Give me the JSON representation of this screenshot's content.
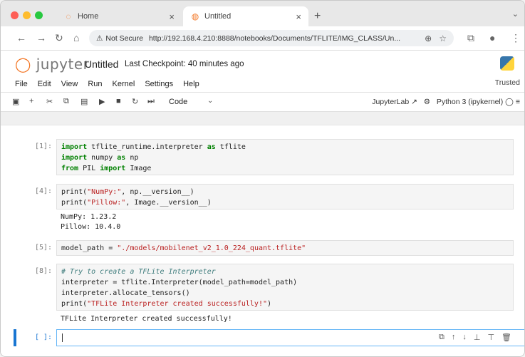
{
  "browser": {
    "tabs": [
      {
        "label": "Home",
        "icon": "loading-ring-icon"
      },
      {
        "label": "Untitled",
        "icon": "jupyter-tab-icon"
      }
    ],
    "security_label": "Not Secure",
    "url": "http://192.168.4.210:8888/notebooks/Documents/TFLITE/IMG_CLASS/Un..."
  },
  "jupyter": {
    "logo_text": "jupyter",
    "notebook_title": "Untitled",
    "checkpoint": "Last Checkpoint: 40 minutes ago",
    "menu": [
      "File",
      "Edit",
      "View",
      "Run",
      "Kernel",
      "Settings",
      "Help"
    ],
    "trusted": "Trusted",
    "cell_type": "Code",
    "jupyterlab_label": "JupyterLab",
    "kernel_name": "Python 3 (ipykernel)"
  },
  "cells": [
    {
      "prompt": "[1]:",
      "lines": [
        "import tflite_runtime.interpreter as tflite",
        "import numpy as np",
        "from PIL import Image"
      ],
      "output": []
    },
    {
      "prompt": "[4]:",
      "lines": [
        "print(\"NumPy:\", np.__version__)",
        "print(\"Pillow:\", Image.__version__)"
      ],
      "output": [
        "NumPy: 1.23.2",
        "Pillow: 10.4.0"
      ]
    },
    {
      "prompt": "[5]:",
      "lines": [
        "model_path = \"./models/mobilenet_v2_1.0_224_quant.tflite\""
      ],
      "output": []
    },
    {
      "prompt": "[8]:",
      "lines": [
        "# Try to create a TFLite Interpreter",
        "interpreter = tflite.Interpreter(model_path=model_path)",
        "interpreter.allocate_tensors()",
        "print(\"TFLite Interpreter created successfully!\")"
      ],
      "output": [
        "TFLite Interpreter created successfully!"
      ]
    },
    {
      "prompt": "[ ]:",
      "lines": [
        ""
      ],
      "output": []
    }
  ],
  "colors": {
    "accent": "#1976d2",
    "keyword": "#008000",
    "string": "#ba2121",
    "comment": "#3d7b7b"
  }
}
